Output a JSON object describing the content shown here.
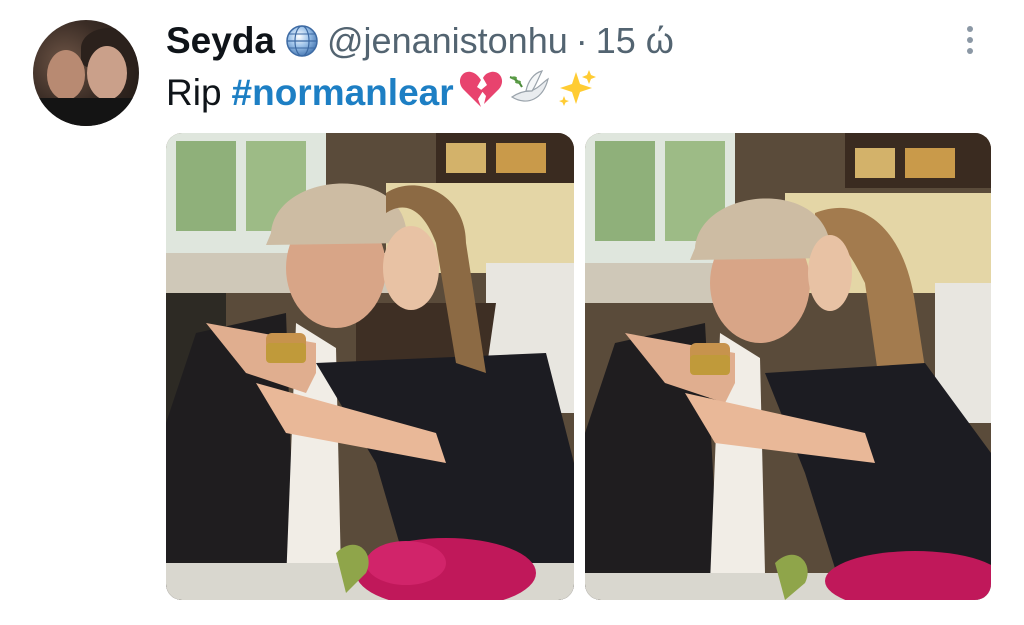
{
  "tweet": {
    "author": {
      "display_name": "Seyda",
      "handle": "@jenanistonhu",
      "badge_icon": "globe-icon"
    },
    "separator": "·",
    "timestamp": "15 ώ",
    "text": {
      "prefix": "Rip",
      "hashtag": "#normanlear",
      "emojis": [
        "broken-heart-icon",
        "dove-icon",
        "sparkles-icon"
      ]
    },
    "media": [
      {
        "alt_icon": "photo-icon"
      },
      {
        "alt_icon": "photo-icon"
      }
    ],
    "more_icon": "more-options-icon"
  },
  "colors": {
    "hashtag": "#1d7fc4",
    "muted": "#536471",
    "text": "#0f1419"
  }
}
